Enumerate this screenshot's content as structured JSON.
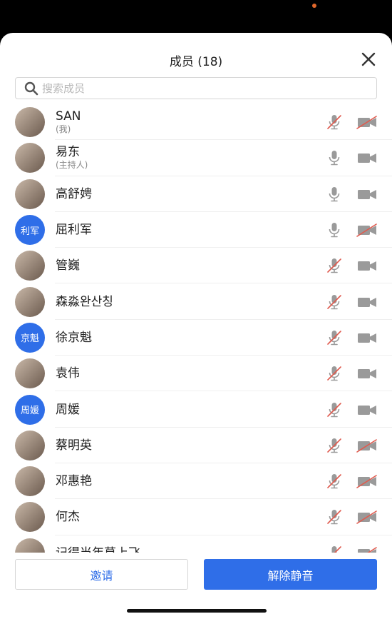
{
  "header": {
    "title": "成员 (18)"
  },
  "search": {
    "placeholder": "搜索成员"
  },
  "members": [
    {
      "name": "SAN",
      "sub": "(我)",
      "avatar": "photo",
      "mic_muted": true,
      "cam_off": true
    },
    {
      "name": "易东",
      "sub": "(主持人)",
      "avatar": "photo",
      "mic_muted": false,
      "cam_off": false
    },
    {
      "name": "高舒娉",
      "sub": "",
      "avatar": "photo",
      "mic_muted": false,
      "cam_off": false
    },
    {
      "name": "屈利军",
      "sub": "",
      "avatar": "text",
      "avatar_text": "利军",
      "mic_muted": false,
      "cam_off": true
    },
    {
      "name": "管巍",
      "sub": "",
      "avatar": "photo",
      "mic_muted": true,
      "cam_off": false
    },
    {
      "name": "森淼완산칭",
      "sub": "",
      "avatar": "photo",
      "mic_muted": true,
      "cam_off": false
    },
    {
      "name": "徐京魁",
      "sub": "",
      "avatar": "text",
      "avatar_text": "京魁",
      "mic_muted": true,
      "cam_off": false
    },
    {
      "name": "袁伟",
      "sub": "",
      "avatar": "photo",
      "mic_muted": true,
      "cam_off": false
    },
    {
      "name": "周媛",
      "sub": "",
      "avatar": "text",
      "avatar_text": "周媛",
      "mic_muted": true,
      "cam_off": false
    },
    {
      "name": "蔡明英",
      "sub": "",
      "avatar": "photo",
      "mic_muted": true,
      "cam_off": true
    },
    {
      "name": "邓惠艳",
      "sub": "",
      "avatar": "photo",
      "mic_muted": true,
      "cam_off": true
    },
    {
      "name": "何杰",
      "sub": "",
      "avatar": "photo",
      "mic_muted": true,
      "cam_off": true
    },
    {
      "name": "记得当年草上飞",
      "sub": "",
      "avatar": "photo",
      "mic_muted": true,
      "cam_off": true
    }
  ],
  "footer": {
    "invite_label": "邀请",
    "unmute_label": "解除静音"
  },
  "colors": {
    "accent": "#2f6ee8",
    "muted_red": "#e05a4e",
    "icon_gray": "#9a9a9a"
  }
}
